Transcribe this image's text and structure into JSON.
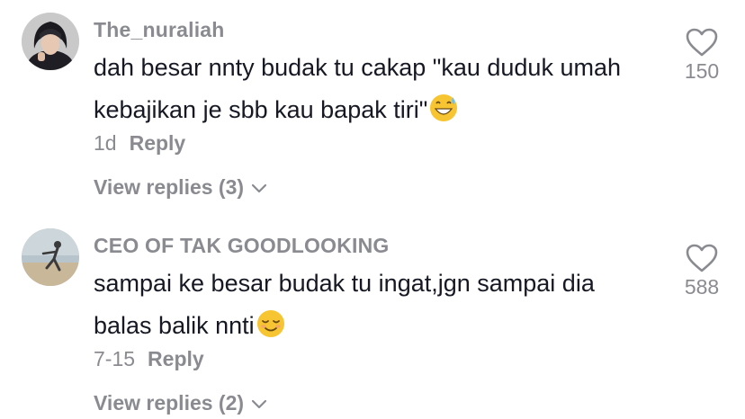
{
  "comments": [
    {
      "username": "The_nuraliah",
      "text": "dah besar nnty budak tu cakap \"kau duduk umah kebajikan je sbb kau bapak tiri\"",
      "emoji": "grinning-sweat-emoji",
      "time": "1d",
      "reply_label": "Reply",
      "view_replies": "View replies (3)",
      "likes": "150"
    },
    {
      "username": "CEO OF TAK GOODLOOKING",
      "text": "sampai ke besar budak tu ingat,jgn sampai dia balas balik nnti",
      "emoji": "relieved-face-emoji",
      "time": "7-15",
      "reply_label": "Reply",
      "view_replies": "View replies (2)",
      "likes": "588"
    }
  ],
  "colors": {
    "text": "#161823",
    "secondary": "#8a8b91",
    "background": "#ffffff"
  },
  "icons": {
    "like": "heart-outline-icon",
    "expand": "chevron-down-icon"
  }
}
